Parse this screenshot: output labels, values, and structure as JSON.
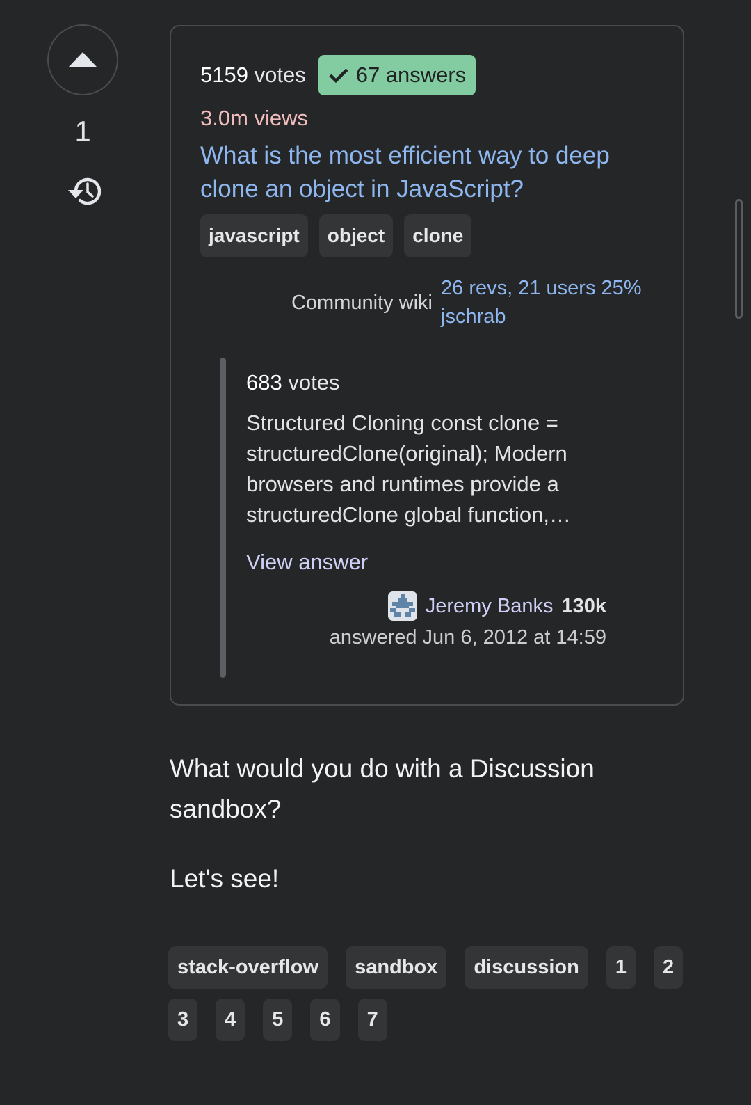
{
  "sidebar": {
    "upvote_icon": "triangle-up-icon",
    "vote_count": "1",
    "history_icon": "history-icon"
  },
  "question": {
    "votes_number": "5159",
    "votes_label": "votes",
    "answers_icon": "checkmark-icon",
    "answers_text": "67 answers",
    "views_text": "3.0m views",
    "title": "What is the most efficient way to deep clone an object in JavaScript?",
    "tags": [
      "javascript",
      "object",
      "clone"
    ],
    "community_label": "Community wiki",
    "wiki_link": "26 revs, 21 users 25% jschrab",
    "colors": {
      "accepted_badge": "#83cba1",
      "title_link": "#8fb7ef",
      "views": "#f0bcbc"
    }
  },
  "answer": {
    "votes_number": "683",
    "votes_label": "votes",
    "excerpt": "Structured Cloning const clone = structuredClone(original); Modern browsers and runtimes provide a structuredClone global function,…",
    "view_answer_label": "View answer",
    "author_name": "Jeremy Banks",
    "author_rep": "130k",
    "answered_text": "answered Jun 6, 2012 at 14:59"
  },
  "post": {
    "paragraphs": [
      "What would you do with a Discussion sandbox?",
      "Let's see!"
    ],
    "tags": [
      "stack-overflow",
      "sandbox",
      "discussion",
      "1",
      "2",
      "3",
      "4",
      "5",
      "6",
      "7"
    ]
  }
}
